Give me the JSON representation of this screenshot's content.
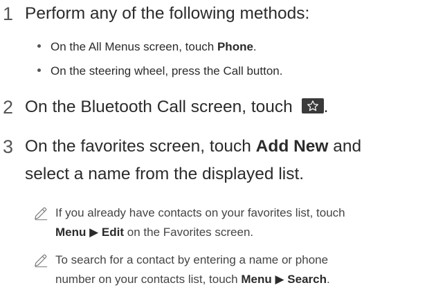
{
  "step1": {
    "number": "1",
    "text": "Perform any of the following methods:",
    "bullets": [
      {
        "before": "On the All Menus screen, touch ",
        "bold": "Phone",
        "after": "."
      },
      {
        "text": "On the steering wheel, press the Call button."
      }
    ]
  },
  "step2": {
    "number": "2",
    "before": "On the Bluetooth Call screen, touch ",
    "after": ".",
    "icon": "star-favorite-icon"
  },
  "step3": {
    "number": "3",
    "before": "On the favorites screen, touch ",
    "bold": "Add New",
    "after_line1": " and",
    "line2": "select a name from the displayed list."
  },
  "notes": [
    {
      "icon": "pencil-note-icon",
      "line1": "If you already have contacts on your favorites list, touch",
      "bold1": "Menu",
      "arrow": " ▶ ",
      "bold2": "Edit",
      "after": " on the Favorites screen."
    },
    {
      "icon": "pencil-note-icon",
      "line1": "To search for a contact by entering a name or phone",
      "before": "number on your contacts list, touch ",
      "bold1": "Menu",
      "arrow": " ▶ ",
      "bold2": "Search",
      "after": "."
    }
  ],
  "colors": {
    "text": "#2b2b2b",
    "note_text": "#444444",
    "icon_bg": "#3a3a3a"
  }
}
